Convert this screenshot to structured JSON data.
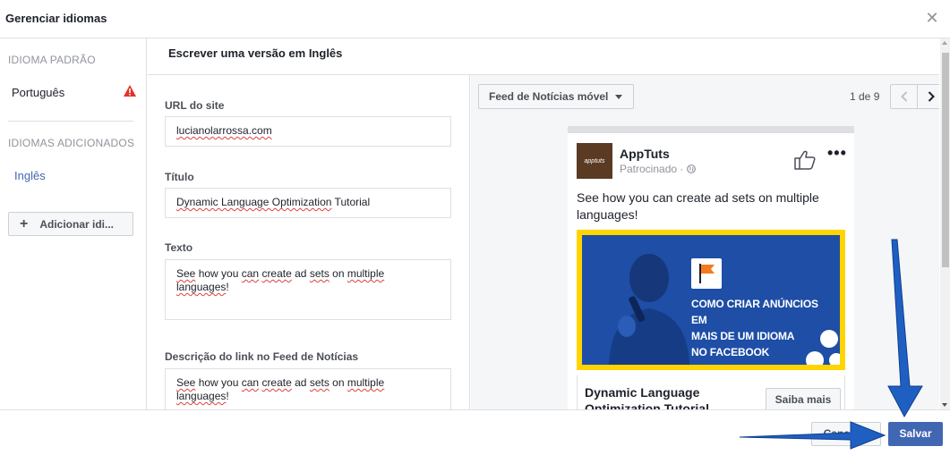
{
  "dialog": {
    "title": "Gerenciar idiomas"
  },
  "sidebar": {
    "default_heading": "IDIOMA PADRÃO",
    "default_language": "Português",
    "added_heading": "IDIOMAS ADICIONADOS",
    "added_language": "Inglês",
    "add_button": "Adicionar idi..."
  },
  "editor": {
    "section_title": "Escrever uma versão em Inglês",
    "url_label": "URL do site",
    "url_value": "lucianolarrossa.com",
    "title_label": "Título",
    "title_value_part1": "Dynamic Language Optimization",
    "title_value_part2": " Tutorial",
    "text_label": "Texto",
    "text_value_1": "See",
    "text_value_2": " how you ",
    "text_value_3": "can",
    "text_value_4": " ",
    "text_value_5": "create",
    "text_value_6": " ad ",
    "text_value_7": "sets",
    "text_value_8": " on ",
    "text_value_9": "multiple",
    "text_value_10": "languages",
    "text_value_11": "!",
    "desc_label": "Descrição do link no Feed de Notícias"
  },
  "preview": {
    "placement": "Feed de Notícias móvel",
    "pager_text": "1 de 9",
    "page_name": "AppTuts",
    "sponsored": "Patrocinado · ",
    "avatar_text": "apptuts",
    "post_text": "See how you can create ad sets on multiple languages!",
    "ad_caption_line1": "COMO CRIAR ANÚNCIOS EM",
    "ad_caption_line2": "MAIS DE UM IDIOMA",
    "ad_caption_line3": "NO FACEBOOK",
    "ad_headline": "Dynamic Language Optimization Tutorial",
    "cta": "Saiba mais"
  },
  "footer": {
    "cancel": "Cancelar",
    "save": "Salvar"
  },
  "colors": {
    "accent": "#4267b2",
    "warning": "#e4312b",
    "ad_frame": "#ffd400",
    "ad_bg": "#1e4ea6",
    "annotation_arrow": "#1f5fc2"
  },
  "icons": {
    "close": "close-icon",
    "warning": "warning-icon",
    "plus": "plus-icon",
    "caret": "caret-down-icon",
    "prev": "chevron-left-icon",
    "next": "chevron-right-icon",
    "like": "thumbs-up-icon",
    "more": "more-options-icon",
    "globe": "globe-icon"
  }
}
